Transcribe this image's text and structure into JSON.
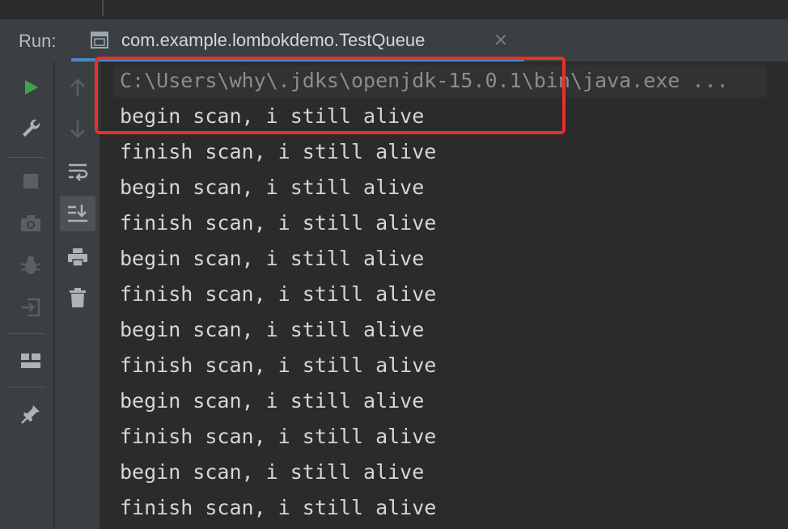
{
  "header": {
    "run_label": "Run:",
    "tab": {
      "title": "com.example.lombokdemo.TestQueue",
      "close_glyph": "×",
      "icon": "console-window-icon"
    }
  },
  "left_toolbar": {
    "buttons": [
      {
        "icon": "run-icon",
        "color": "#3fa34d"
      },
      {
        "icon": "wrench-icon"
      },
      {
        "icon": "stop-icon"
      },
      {
        "icon": "camera-icon"
      },
      {
        "icon": "debug-bug-icon"
      },
      {
        "icon": "exit-login-icon"
      },
      {
        "icon": "layout-icon"
      },
      {
        "icon": "pin-icon"
      }
    ]
  },
  "inner_toolbar": {
    "buttons": [
      {
        "icon": "arrow-up-icon"
      },
      {
        "icon": "arrow-down-icon"
      },
      {
        "icon": "soft-wrap-icon"
      },
      {
        "icon": "scroll-to-end-icon",
        "active": true
      },
      {
        "icon": "print-icon"
      },
      {
        "icon": "trash-icon"
      }
    ]
  },
  "console": {
    "command": "C:\\Users\\why\\.jdks\\openjdk-15.0.1\\bin\\java.exe ...",
    "lines": [
      "begin scan, i still alive",
      "finish scan, i still alive",
      "begin scan, i still alive",
      "finish scan, i still alive",
      "begin scan, i still alive",
      "finish scan, i still alive",
      "begin scan, i still alive",
      "finish scan, i still alive",
      "begin scan, i still alive",
      "finish scan, i still alive",
      "begin scan, i still alive",
      "finish scan, i still alive"
    ]
  },
  "colors": {
    "accent": "#4a88c7",
    "highlight": "#e8302a",
    "run_green": "#3fa34d"
  }
}
